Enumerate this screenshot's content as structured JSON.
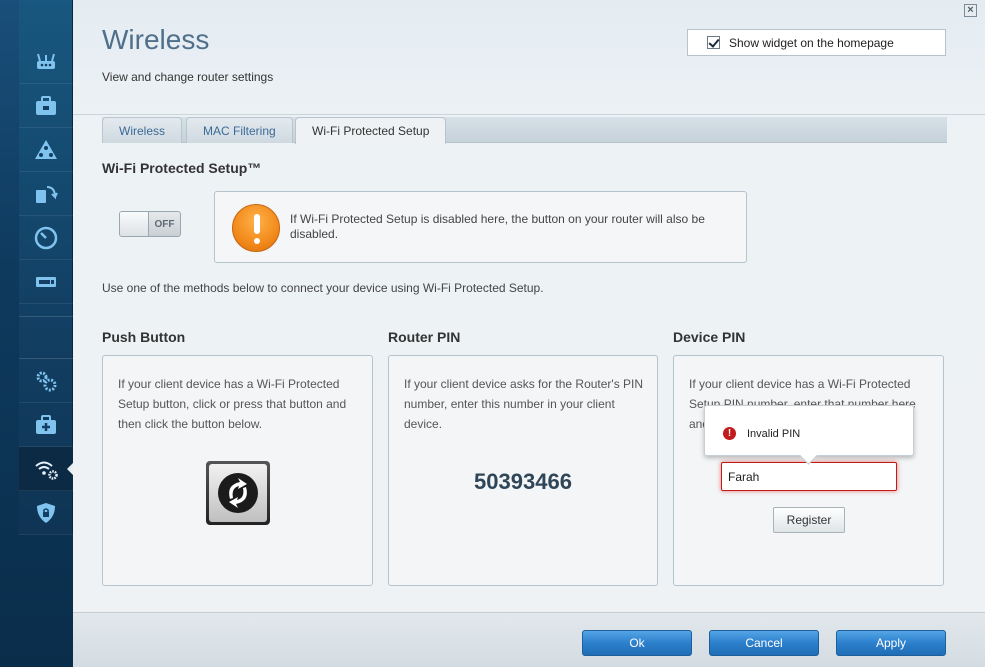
{
  "nav": {
    "items": [
      {
        "name": "router-icon"
      },
      {
        "name": "toolbox-icon"
      },
      {
        "name": "network-map-icon"
      },
      {
        "name": "connectivity-icon"
      },
      {
        "name": "speed-test-icon"
      },
      {
        "name": "usb-storage-icon"
      },
      {
        "name": "settings-gears-icon"
      },
      {
        "name": "troubleshooting-icon"
      },
      {
        "name": "wireless-settings-icon"
      },
      {
        "name": "security-icon"
      }
    ],
    "active": "wireless-settings-icon"
  },
  "header": {
    "title": "Wireless",
    "subtitle": "View and change router settings",
    "widget_label": "Show widget on the homepage",
    "widget_checked": true
  },
  "tabs": [
    {
      "label": "Wireless",
      "active": false
    },
    {
      "label": "MAC Filtering",
      "active": false
    },
    {
      "label": "Wi-Fi Protected Setup",
      "active": true
    }
  ],
  "wps": {
    "title": "Wi-Fi Protected Setup™",
    "toggle_label": "OFF",
    "warning": "If Wi-Fi Protected Setup is disabled here, the button on your router will also be disabled.",
    "instructions": "Use one of the methods below to connect your device using Wi-Fi Protected Setup."
  },
  "push_button": {
    "title": "Push Button",
    "text": "If your client device has a Wi-Fi Protected Setup button, click or press that button and then click the button below."
  },
  "router_pin": {
    "title": "Router PIN",
    "text": "If your client device asks for the Router's PIN number, enter this number in your client device.",
    "pin": "50393466"
  },
  "device_pin": {
    "title": "Device PIN",
    "text": "If your client device has a Wi-Fi Protected Setup PIN number, enter that number here and",
    "input_value": "Farah",
    "register_label": "Register",
    "error": "Invalid PIN"
  },
  "footer": {
    "ok": "Ok",
    "cancel": "Cancel",
    "apply": "Apply"
  }
}
